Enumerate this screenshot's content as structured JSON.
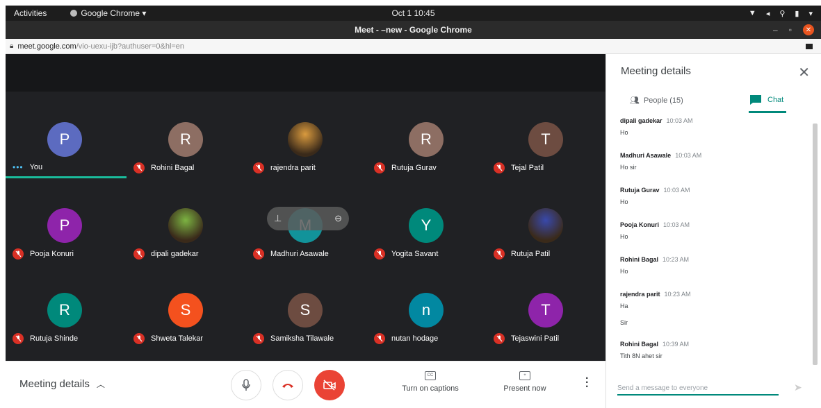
{
  "system": {
    "activities": "Activities",
    "app_menu": "Google Chrome ▾",
    "clock": "Oct 1  10:45"
  },
  "window": {
    "title": "Meet - –new - Google Chrome"
  },
  "urlbar": {
    "host": "meet.google.com",
    "path": "/vio-uexu-ijb?authuser=0&hl=en"
  },
  "stage": {
    "you_label": "You",
    "participants": [
      {
        "name": "",
        "initial": "P",
        "color": "#5c6bc0"
      },
      {
        "name": "Rohini Bagal",
        "initial": "R",
        "color": "#8d6e63"
      },
      {
        "name": "rajendra parit",
        "initial": "",
        "color": "#d99a3e",
        "photo": true
      },
      {
        "name": "Rutuja Gurav",
        "initial": "R",
        "color": "#8d6e63"
      },
      {
        "name": "Tejal Patil",
        "initial": "T",
        "color": "#6d4c41"
      },
      {
        "name": "Pooja Konuri",
        "initial": "P",
        "color": "#8e24aa"
      },
      {
        "name": "dipali gadekar",
        "initial": "",
        "color": "#7cb342",
        "photo": true
      },
      {
        "name": "Madhuri Asawale",
        "initial": "M",
        "color": "#12939a"
      },
      {
        "name": "Yogita Savant",
        "initial": "Y",
        "color": "#00897b"
      },
      {
        "name": "Rutuja Patil",
        "initial": "",
        "color": "#3949ab",
        "photo": true
      },
      {
        "name": "Rutuja Shinde",
        "initial": "R",
        "color": "#00897b"
      },
      {
        "name": "Shweta Talekar",
        "initial": "S",
        "color": "#f4511e"
      },
      {
        "name": "Samiksha Tilawale",
        "initial": "S",
        "color": "#6d4c41"
      },
      {
        "name": "nutan hodage",
        "initial": "n",
        "color": "#0288a1"
      },
      {
        "name": "Tejaswini Patil",
        "initial": "T",
        "color": "#8e24aa"
      }
    ]
  },
  "controls": {
    "meeting_details": "Meeting details",
    "captions": "Turn on captions",
    "present": "Present now"
  },
  "panel": {
    "title": "Meeting details",
    "people_tab": "People (15)",
    "chat_tab": "Chat",
    "messages": [
      {
        "sender": "dipali gadekar",
        "time": "10:03 AM",
        "lines": [
          "Ho"
        ]
      },
      {
        "sender": "Madhuri Asawale",
        "time": "10:03 AM",
        "lines": [
          "Ho sir"
        ]
      },
      {
        "sender": "Rutuja Gurav",
        "time": "10:03 AM",
        "lines": [
          "Ho"
        ]
      },
      {
        "sender": "Pooja Konuri",
        "time": "10:03 AM",
        "lines": [
          "Ho"
        ]
      },
      {
        "sender": "Rohini Bagal",
        "time": "10:23 AM",
        "lines": [
          "Ho"
        ]
      },
      {
        "sender": "rajendra parit",
        "time": "10:23 AM",
        "lines": [
          "Ha",
          "Sir"
        ]
      },
      {
        "sender": "Rohini Bagal",
        "time": "10:39 AM",
        "lines": [
          "Tith 8N ahet sir"
        ]
      }
    ],
    "composer_placeholder": "Send a message to everyone"
  }
}
